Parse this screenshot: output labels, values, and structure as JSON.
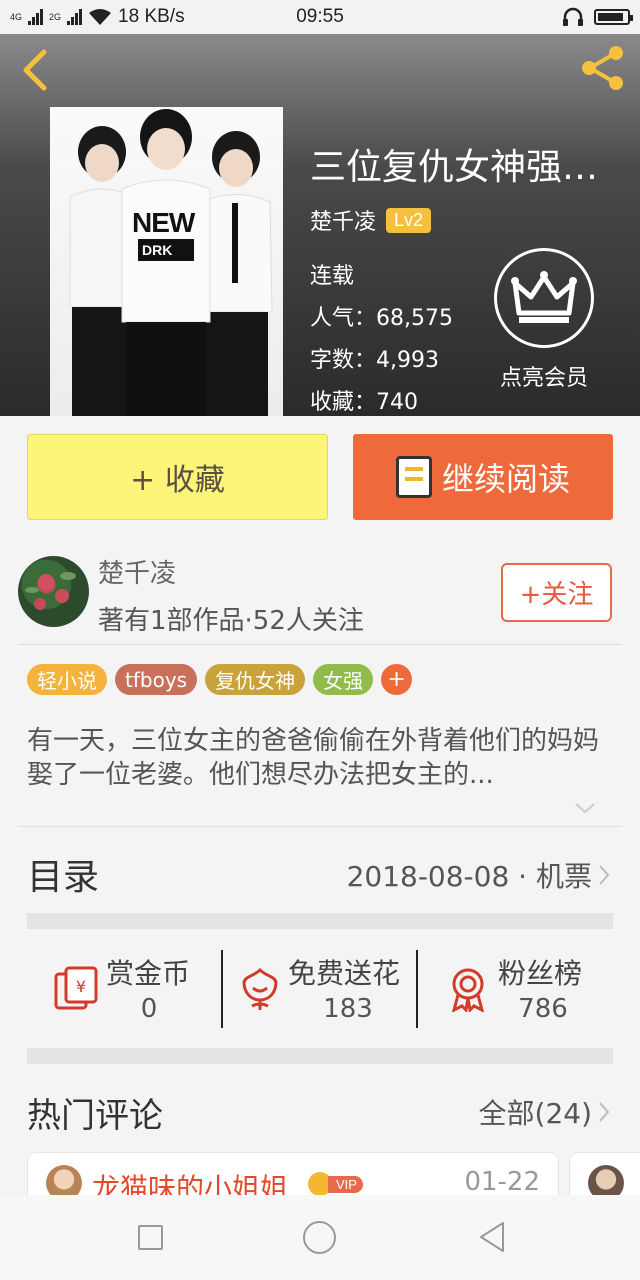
{
  "status_bar": {
    "network_4g": "4G",
    "network_2g": "2G",
    "speed": "18 KB/s",
    "time": "09:55",
    "battery_level": 0.9
  },
  "header": {
    "book_title": "三位复仇女神强势...",
    "author": "楚千凌",
    "level": "Lv2",
    "status": "连载",
    "popularity": "人气：68,575",
    "word_count": "字数：4,993",
    "favorites": "收藏：740",
    "vip_label": "点亮会员",
    "cover_shirt_text": "NEW",
    "cover_shirt_sub": "DRK"
  },
  "actions": {
    "collect_label": "+ 收藏",
    "read_label": "继续阅读"
  },
  "author": {
    "name": "楚千凌",
    "subtitle": "著有1部作品·52人关注",
    "follow_label": "+关注"
  },
  "tags": [
    {
      "label": "轻小说",
      "color": "#f5b23d"
    },
    {
      "label": "tfboys",
      "color": "#c8705a"
    },
    {
      "label": "复仇女神",
      "color": "#c9a33a"
    },
    {
      "label": "女强",
      "color": "#8fbc4a"
    }
  ],
  "tag_add": "+",
  "description": "有一天，三位女主的爸爸偷偷在外背着他们的妈妈娶了一位老婆。他们想尽办法把女主的...",
  "toc": {
    "title": "目录",
    "latest": "2018-08-08 · 机票"
  },
  "rewards": [
    {
      "label": "赏金币",
      "value": "0",
      "icon": "red-envelope-icon"
    },
    {
      "label": "免费送花",
      "value": "183",
      "icon": "flower-icon"
    },
    {
      "label": "粉丝榜",
      "value": "786",
      "icon": "medal-icon"
    }
  ],
  "comments": {
    "title": "热门评论",
    "all_label": "全部(24)",
    "items": [
      {
        "name": "龙猫味的小姐姐",
        "badge": "VIP",
        "date": "01-22"
      }
    ]
  },
  "colors": {
    "accent_orange": "#ef6a3a",
    "collect_yellow": "#fcf57a",
    "lv_badge": "#f5c03d"
  }
}
